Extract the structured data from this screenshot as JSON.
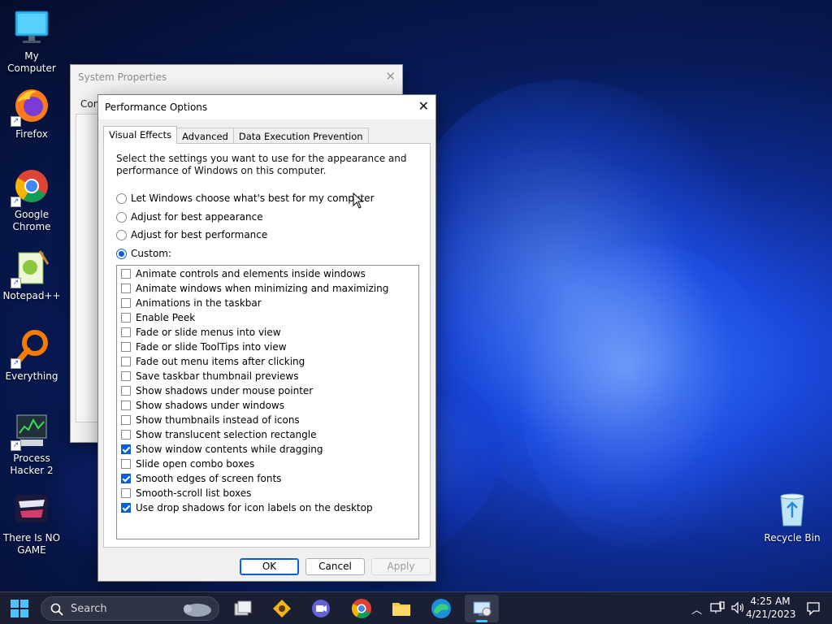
{
  "desktop": {
    "icons": [
      {
        "label": "My Computer"
      },
      {
        "label": "Firefox"
      },
      {
        "label": "Google Chrome"
      },
      {
        "label": "Notepad++"
      },
      {
        "label": "Everything"
      },
      {
        "label": "Process Hacker 2"
      },
      {
        "label": "There Is NO GAME"
      },
      {
        "label": "Recycle Bin"
      }
    ]
  },
  "system_properties": {
    "title": "System Properties",
    "tab_fragment": "Com"
  },
  "dialog": {
    "title": "Performance Options",
    "tabs": [
      {
        "label": "Visual Effects",
        "active": true
      },
      {
        "label": "Advanced",
        "active": false
      },
      {
        "label": "Data Execution Prevention",
        "active": false
      }
    ],
    "description": "Select the settings you want to use for the appearance and performance of Windows on this computer.",
    "radios": [
      {
        "label": "Let Windows choose what's best for my computer",
        "selected": false
      },
      {
        "label": "Adjust for best appearance",
        "selected": false
      },
      {
        "label": "Adjust for best performance",
        "selected": false
      },
      {
        "label": "Custom:",
        "selected": true
      }
    ],
    "effects": [
      {
        "label": "Animate controls and elements inside windows",
        "checked": false
      },
      {
        "label": "Animate windows when minimizing and maximizing",
        "checked": false
      },
      {
        "label": "Animations in the taskbar",
        "checked": false
      },
      {
        "label": "Enable Peek",
        "checked": false
      },
      {
        "label": "Fade or slide menus into view",
        "checked": false
      },
      {
        "label": "Fade or slide ToolTips into view",
        "checked": false
      },
      {
        "label": "Fade out menu items after clicking",
        "checked": false
      },
      {
        "label": "Save taskbar thumbnail previews",
        "checked": false
      },
      {
        "label": "Show shadows under mouse pointer",
        "checked": false
      },
      {
        "label": "Show shadows under windows",
        "checked": false
      },
      {
        "label": "Show thumbnails instead of icons",
        "checked": false
      },
      {
        "label": "Show translucent selection rectangle",
        "checked": false
      },
      {
        "label": "Show window contents while dragging",
        "checked": true
      },
      {
        "label": "Slide open combo boxes",
        "checked": false
      },
      {
        "label": "Smooth edges of screen fonts",
        "checked": true
      },
      {
        "label": "Smooth-scroll list boxes",
        "checked": false
      },
      {
        "label": "Use drop shadows for icon labels on the desktop",
        "checked": true
      }
    ],
    "buttons": {
      "ok": "OK",
      "cancel": "Cancel",
      "apply": "Apply"
    },
    "accent_color": "#0a5fd8"
  },
  "taskbar": {
    "search_placeholder": "Search",
    "time": "4:25 AM",
    "date": "4/21/2023",
    "pinned": [
      "task-view-icon",
      "app-icon",
      "teams-icon",
      "chrome-icon",
      "file-explorer-icon",
      "edge-icon",
      "system-properties-icon"
    ]
  }
}
